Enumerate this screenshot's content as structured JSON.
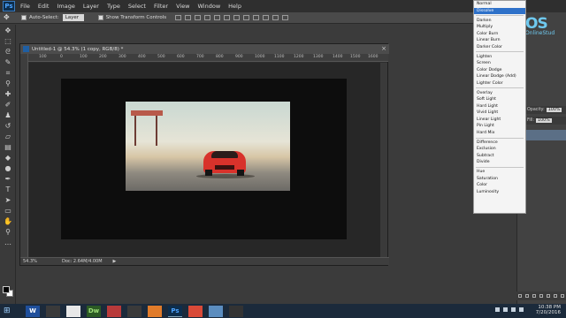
{
  "menu": {
    "logo": "Ps",
    "items": [
      "File",
      "Edit",
      "Image",
      "Layer",
      "Type",
      "Select",
      "Filter",
      "View",
      "Window",
      "Help"
    ]
  },
  "options": {
    "auto_select_label": "Auto-Select:",
    "auto_select_value": "Layer",
    "transform_label": "Show Transform Controls"
  },
  "document": {
    "title": "Untitled-1 @ 54.3% (1 copy, RGB/8) *",
    "ruler_ticks": [
      "100",
      "0",
      "100",
      "200",
      "300",
      "400",
      "500",
      "600",
      "700",
      "800",
      "900",
      "1000",
      "1100",
      "1200",
      "1300",
      "1400",
      "1500",
      "1600",
      "1700"
    ],
    "zoom": "54.3%",
    "doc_info": "Doc: 2.64M/4.00M"
  },
  "blend_modes": {
    "groups": [
      [
        "Normal",
        "Dissolve"
      ],
      [
        "Darken",
        "Multiply",
        "Color Burn",
        "Linear Burn",
        "Darker Color"
      ],
      [
        "Lighten",
        "Screen",
        "Color Dodge",
        "Linear Dodge (Add)",
        "Lighter Color"
      ],
      [
        "Overlay",
        "Soft Light",
        "Hard Light",
        "Vivid Light",
        "Linear Light",
        "Pin Light",
        "Hard Mix"
      ],
      [
        "Difference",
        "Exclusion",
        "Subtract",
        "Divide"
      ],
      [
        "Hue",
        "Saturation",
        "Color",
        "Luminosity"
      ]
    ],
    "selected": "Dissolve"
  },
  "layers_panel": {
    "opacity_label": "Opacity:",
    "opacity_value": "100%",
    "fill_label": "Fill:",
    "fill_value": "100%"
  },
  "watermark": {
    "logo": "OS",
    "text": "OnlineStud"
  },
  "taskbar": {
    "apps": [
      "W",
      "",
      "",
      "Dw",
      "",
      "",
      "",
      "Ps",
      "",
      "",
      ""
    ],
    "time": "10:38 PM",
    "date": "7/20/2016"
  },
  "colors": {
    "accent": "#2e71c9",
    "ps_blue": "#4da3ff",
    "watermark": "#6fc9ef"
  }
}
